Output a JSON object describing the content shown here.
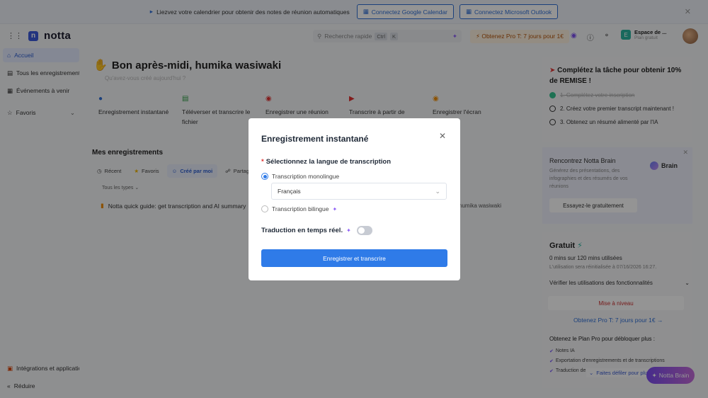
{
  "banner": {
    "message": "Liezvez votre calendrier pour obtenir des notes de réunion automatiques",
    "google_button": "Connectez Google Calendar",
    "outlook_button": "Connectez Microsoft Outlook"
  },
  "header": {
    "app_name": "notta",
    "search_placeholder": "Recherche rapide",
    "shortcut_ctrl": "Ctrl",
    "shortcut_k": "K",
    "pro_offer": "Obtenez Pro T: 7 jours pour 1€",
    "workspace_badge": "E",
    "workspace_title": "Espace de ...",
    "workspace_plan": "Plan gratuit"
  },
  "sidebar": {
    "items": [
      {
        "label": "Accueil"
      },
      {
        "label": "Tous les enregistrements"
      },
      {
        "label": "Événements à venir"
      },
      {
        "label": "Favoris"
      }
    ],
    "integrations": "Intégrations et applications",
    "collapse": "Réduire"
  },
  "main": {
    "greeting": "Bon après-midi, humika wasiwaki",
    "subtitle": "Qu'avez-vous créé aujourd'hui ?",
    "actions": [
      {
        "label": "Enregistrement instantané"
      },
      {
        "label": "Téléverser et transcrire le fichier"
      },
      {
        "label": "Enregistrer une réunion"
      },
      {
        "label": "Transcrire à partir de"
      },
      {
        "label": "Enregistrer l'écran"
      }
    ],
    "recordings_title": "Mes enregistrements",
    "filters": [
      {
        "label": "Récent"
      },
      {
        "label": "Favoris"
      },
      {
        "label": "Créé par moi"
      },
      {
        "label": "Partagé"
      }
    ],
    "types_label": "Tous les types",
    "recording_title": "Notta quick guide: get transcription and AI summary",
    "recording_owner": "humika wasiwaki"
  },
  "right_panel": {
    "task_title": "Complétez la tâche pour obtenir 10% de REMISE !",
    "steps": [
      {
        "label": "1. Complétez votre inscription"
      },
      {
        "label": "2. Créez votre premier transcript maintenant !"
      },
      {
        "label": "3. Obtenez un résumé alimenté par l'IA"
      }
    ],
    "brain_title": "Rencontrez Notta Brain",
    "brain_desc": "Générez des présentations, des infographies et des résumés de vos réunions",
    "brain_button": "Essayez-le gratuitement",
    "brain_badge": "Brain",
    "plan_name": "Gratuit",
    "usage": "0 mins sur 120 mins utilisées",
    "reset": "L'utilisation sera réinitialisée à 07/16/2026 16:27.",
    "features_link": "Vérifier les utilisations des fonctionnalités",
    "upgrade_button": "Mise à niveau",
    "pro_link": "Obtenez Pro T: 7 jours pour 1€ →",
    "unlock_title": "Obtenez le Plan Pro pour débloquer plus :",
    "bullets": [
      {
        "label": "Notes IA"
      },
      {
        "label": "Exportation d'enregistrements et de transcriptions"
      },
      {
        "label": "Traduction de"
      }
    ]
  },
  "floating": {
    "scroll_hint": "Faites défiler pour plus",
    "brain_button": "Notta Brain"
  },
  "modal": {
    "title": "Enregistrement instantané",
    "required_mark": "*",
    "question": "Sélectionnez la langue de transcription",
    "option_mono": "Transcription monolingue",
    "selected_language": "Français",
    "option_bi": "Transcription bilingue",
    "live_translation": "Traduction en temps réel.",
    "primary_button": "Enregistrer et transcrire"
  }
}
